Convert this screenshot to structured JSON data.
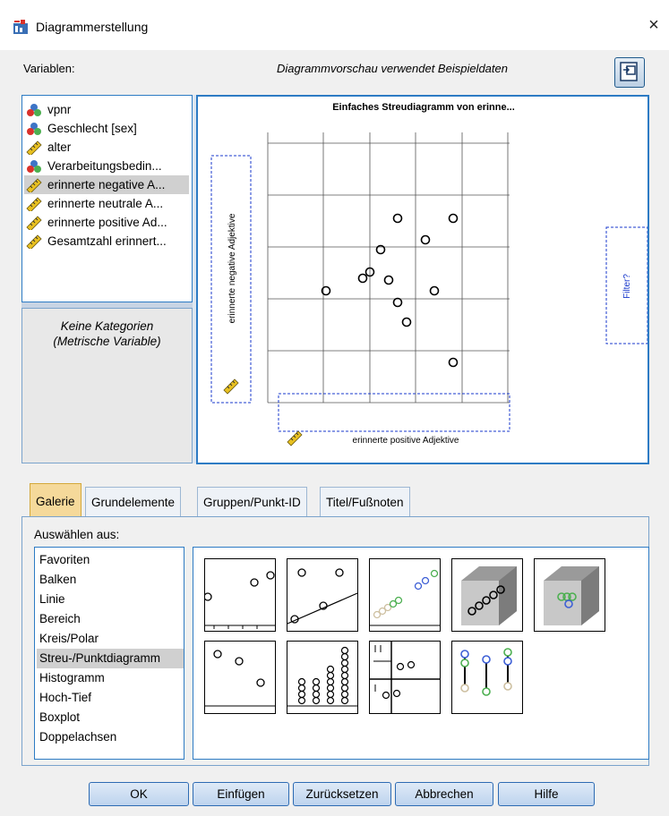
{
  "window": {
    "title": "Diagrammerstellung",
    "close_glyph": "×"
  },
  "labels": {
    "variables": "Variablen:",
    "preview_note": "Diagrammvorschau verwendet Beispieldaten",
    "no_categories_line1": "Keine Kategorien",
    "no_categories_line2": "(Metrische Variable)",
    "choose_from": "Auswählen aus:"
  },
  "variables": [
    {
      "label": "vpnr",
      "icon": "nominal-icon",
      "selected": false
    },
    {
      "label": "Geschlecht [sex]",
      "icon": "nominal-icon",
      "selected": false
    },
    {
      "label": "alter",
      "icon": "scale-ruler-icon",
      "selected": false
    },
    {
      "label": "Verarbeitungsbedin...",
      "icon": "nominal-icon",
      "selected": false
    },
    {
      "label": "erinnerte negative A...",
      "icon": "scale-ruler-icon",
      "selected": true
    },
    {
      "label": "erinnerte neutrale A...",
      "icon": "scale-ruler-icon",
      "selected": false
    },
    {
      "label": "erinnerte positive Ad...",
      "icon": "scale-ruler-icon",
      "selected": false
    },
    {
      "label": "Gesamtzahl erinnert...",
      "icon": "scale-ruler-icon",
      "selected": false
    }
  ],
  "preview": {
    "title": "Einfaches Streudiagramm  von erinne...",
    "y_drop_label": "erinnerte negative Adjektive",
    "x_drop_label": "erinnerte positive Adjektive",
    "filter_label": "Filter?"
  },
  "tabs": [
    {
      "label": "Galerie",
      "active": true
    },
    {
      "label": "Grundelemente",
      "active": false
    },
    {
      "label": "Gruppen/Punkt-ID",
      "active": false
    },
    {
      "label": "Titel/Fußnoten",
      "active": false
    }
  ],
  "chart_types": [
    {
      "label": "Favoriten",
      "selected": false
    },
    {
      "label": "Balken",
      "selected": false
    },
    {
      "label": "Linie",
      "selected": false
    },
    {
      "label": "Bereich",
      "selected": false
    },
    {
      "label": "Kreis/Polar",
      "selected": false
    },
    {
      "label": "Streu-/Punktdiagramm",
      "selected": true
    },
    {
      "label": "Histogramm",
      "selected": false
    },
    {
      "label": "Hoch-Tief",
      "selected": false
    },
    {
      "label": "Boxplot",
      "selected": false
    },
    {
      "label": "Doppelachsen",
      "selected": false
    }
  ],
  "gallery_thumbnails": [
    "simple-scatter-icon",
    "scatter-with-fitline-icon",
    "grouped-scatter-icon",
    "3d-scatter-icon",
    "grouped-3d-scatter-icon",
    "summary-point-icon",
    "simple-dot-plot-icon",
    "scatterplot-matrix-icon",
    "drop-line-icon"
  ],
  "buttons": {
    "ok": "OK",
    "paste": "Einfügen",
    "reset": "Zurücksetzen",
    "cancel": "Abbrechen",
    "help": "Hilfe"
  },
  "colors": {
    "accent_border": "#2d7bc4",
    "active_tab": "#f5d99a",
    "selection": "#d0d0d0",
    "button_border": "#2d6bb3"
  }
}
